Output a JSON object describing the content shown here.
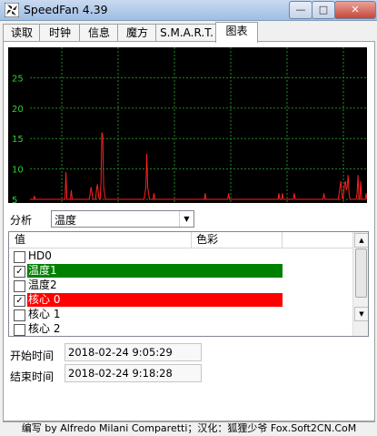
{
  "window": {
    "title": "SpeedFan 4.39",
    "icon": "speedfan-fan-icon"
  },
  "titlebar_buttons": [
    {
      "name": "minimize-button",
      "glyph": "—"
    },
    {
      "name": "maximize-button",
      "glyph": "□"
    },
    {
      "name": "close-button",
      "glyph": "✕"
    }
  ],
  "tabs": [
    {
      "label": "读取",
      "active": false
    },
    {
      "label": "时钟",
      "active": false
    },
    {
      "label": "信息",
      "active": false
    },
    {
      "label": "魔方",
      "active": false
    },
    {
      "label": "S.M.A.R.T.",
      "active": false
    },
    {
      "label": "图表",
      "active": true
    }
  ],
  "chart_data": {
    "type": "line",
    "ylim": [
      5,
      30
    ],
    "y_ticks": [
      "25",
      "20",
      "15",
      "10",
      "5"
    ],
    "grid": true,
    "background": "#000000",
    "grid_color": "#1f8a1f",
    "tick_color": "#2fd12f",
    "series": [
      {
        "color": "#ff2020",
        "values": [
          5,
          5,
          5,
          5,
          5,
          5.5,
          5,
          5,
          5,
          5,
          5,
          5,
          5,
          5,
          5,
          5,
          5,
          5,
          5,
          5,
          5,
          5,
          5,
          5,
          5,
          5,
          5,
          5,
          5,
          5,
          5,
          5,
          5,
          5,
          5,
          5,
          5,
          5,
          5,
          5,
          9.5,
          5,
          5,
          5,
          5,
          5,
          6.5,
          5,
          5,
          5,
          5,
          5,
          5,
          5,
          5,
          5,
          5,
          5,
          5,
          5,
          5,
          5,
          5,
          5,
          5,
          5,
          5,
          6,
          7,
          6,
          5,
          5,
          5,
          5,
          6.5,
          7.5,
          6,
          5,
          5,
          8,
          16,
          15.5,
          7,
          6,
          5,
          5,
          5,
          5,
          5,
          5,
          5,
          5,
          5,
          5,
          5,
          5,
          5,
          5,
          5,
          5,
          5,
          5,
          5,
          5,
          5,
          5,
          5,
          5,
          5,
          5,
          5,
          5,
          5,
          5,
          5,
          5,
          5,
          5,
          5,
          5,
          5,
          5,
          5,
          5,
          5,
          5,
          5,
          5,
          6,
          7,
          12.5,
          7,
          6,
          5,
          5,
          5,
          5,
          5,
          6,
          5,
          5,
          5,
          5,
          5,
          5,
          5,
          5,
          5,
          5,
          5,
          5,
          5,
          5,
          5,
          5,
          5,
          5,
          5,
          5,
          5,
          5,
          5,
          5,
          5,
          5,
          5,
          5,
          5,
          5,
          5,
          5,
          5,
          5,
          5,
          5,
          5,
          5,
          5,
          5,
          5,
          5,
          5,
          5,
          5,
          5,
          5,
          5,
          5,
          5,
          5,
          5,
          5,
          5,
          5,
          5,
          6,
          5,
          5,
          5,
          5,
          5,
          5,
          5,
          5,
          5,
          5,
          5,
          5,
          5,
          5,
          5,
          5,
          5,
          5,
          5,
          5,
          5,
          5,
          5,
          5,
          5,
          6,
          5,
          5,
          5,
          5,
          5,
          5,
          5,
          5,
          5,
          5,
          5,
          5,
          5,
          5,
          5,
          5,
          5,
          5,
          5,
          5,
          5,
          5,
          5,
          5,
          5,
          5,
          5,
          5,
          5,
          5,
          5,
          5,
          5,
          5,
          5,
          5,
          5,
          5,
          5,
          5,
          5,
          5,
          5,
          5,
          5,
          5,
          5,
          5,
          5,
          5,
          5,
          5,
          5,
          5,
          5,
          6,
          5,
          5,
          5,
          6,
          5,
          5,
          5,
          5,
          5,
          5,
          5,
          5,
          5,
          5,
          5,
          5,
          6,
          5,
          5,
          5,
          5,
          5,
          5,
          5,
          5,
          5,
          5,
          5,
          5,
          5,
          5,
          5,
          5,
          5,
          5,
          5,
          5,
          5,
          5,
          5,
          5,
          5,
          5,
          5,
          5,
          5,
          5,
          5,
          5,
          6,
          5,
          5,
          5,
          5,
          5,
          5,
          5,
          5,
          5,
          5,
          5,
          5,
          5,
          5,
          5,
          5,
          6,
          7,
          8,
          6,
          5,
          6,
          7.5,
          8,
          6.5,
          7,
          9,
          6,
          5,
          5,
          5,
          5,
          5,
          5,
          5,
          5,
          6,
          9,
          5,
          5,
          8,
          5,
          5,
          5,
          5,
          5,
          6,
          5
        ]
      }
    ]
  },
  "analysis": {
    "label": "分析",
    "selected": "温度"
  },
  "list": {
    "columns": [
      "值",
      "色彩"
    ],
    "rows": [
      {
        "label": "HD0",
        "checked": false,
        "color": null
      },
      {
        "label": "温度1",
        "checked": true,
        "color": "#008000"
      },
      {
        "label": "温度2",
        "checked": false,
        "color": null
      },
      {
        "label": "核心 0",
        "checked": true,
        "color": "#ff0000"
      },
      {
        "label": "核心 1",
        "checked": false,
        "color": null
      },
      {
        "label": "核心 2",
        "checked": false,
        "color": null
      }
    ]
  },
  "start": {
    "label": "开始时间",
    "value": "2018-02-24 9:05:29"
  },
  "end": {
    "label": "结束时间",
    "value": "2018-02-24 9:18:28"
  },
  "status": "编写 by Alfredo Milani Comparetti；汉化：狐狸少爷 Fox.Soft2CN.CoM"
}
